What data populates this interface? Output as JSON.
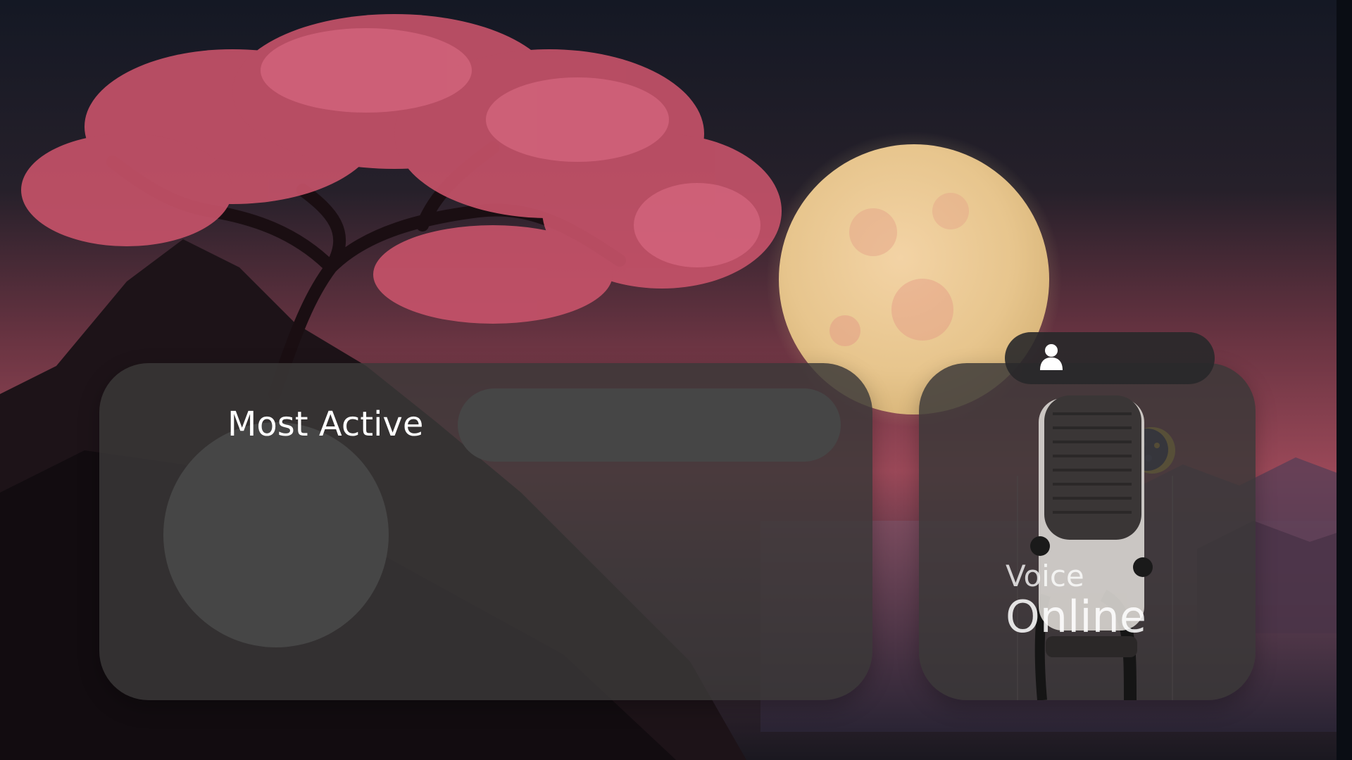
{
  "most_active": {
    "label": "Most Active",
    "badge_icon": "moon-icon"
  },
  "avatar": {
    "icon": "avatar-placeholder"
  },
  "voice": {
    "label": "Voice",
    "status": "Online",
    "icon": "microphone-icon"
  },
  "user_pill": {
    "icon": "user-icon"
  },
  "colors": {
    "card_bg": "#3a3838",
    "pill_bg": "#464646",
    "text": "#ffffff",
    "moon_yellow": "#e8c93a"
  }
}
